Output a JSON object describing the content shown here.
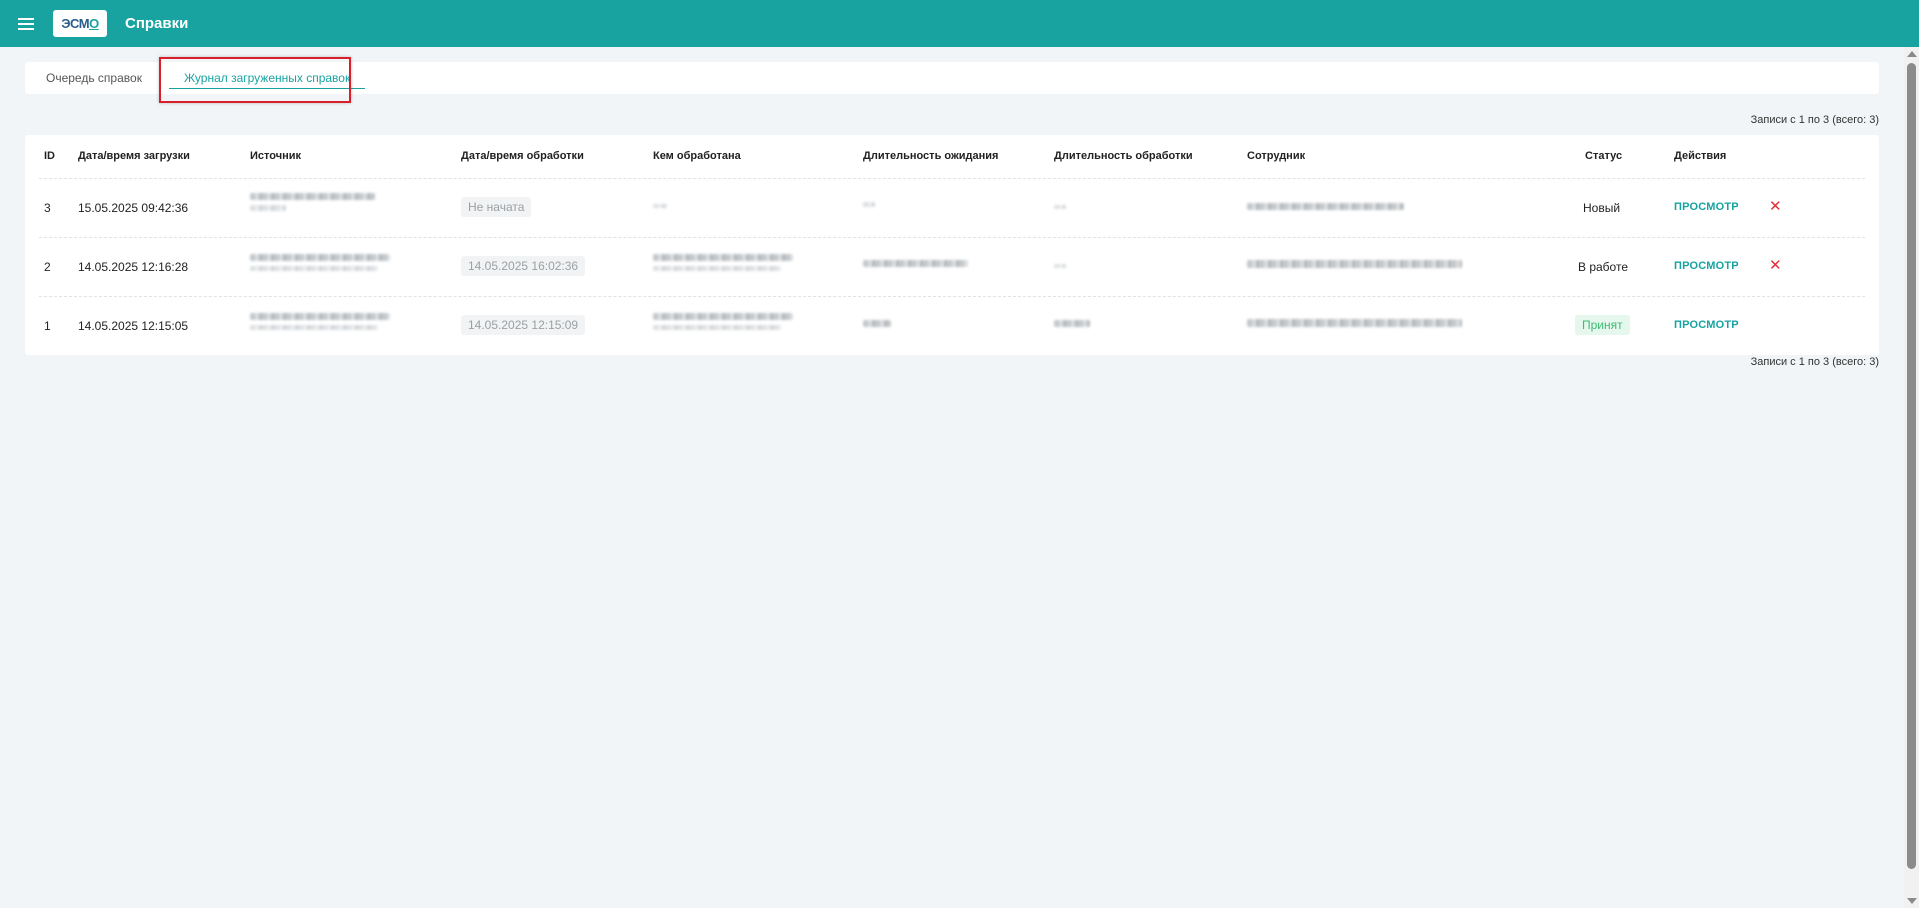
{
  "header": {
    "logo_text_main": "ЭСМ",
    "logo_text_accent": "О",
    "title": "Справки"
  },
  "tabs": [
    {
      "label": "Очередь справок",
      "active": false
    },
    {
      "label": "Журнал загруженных справок",
      "active": true
    }
  ],
  "records_info": "Записи с 1 по 3 (всего: 3)",
  "table": {
    "columns": {
      "id": "ID",
      "uploaded_at": "Дата/время загрузки",
      "source": "Источник",
      "processed_at": "Дата/время обработки",
      "processed_by": "Кем обработана",
      "wait_duration": "Длительность ожидания",
      "process_duration": "Длительность обработки",
      "employee": "Сотрудник",
      "status": "Статус",
      "actions": "Действия"
    },
    "rows": [
      {
        "id": "3",
        "uploaded_at": "15.05.2025 09:42:36",
        "processed_at": "Не начата",
        "status": "Новый",
        "view": "ПРОСМОТР",
        "deletable": true
      },
      {
        "id": "2",
        "uploaded_at": "14.05.2025 12:16:28",
        "processed_at": "14.05.2025 16:02:36",
        "status": "В работе",
        "view": "ПРОСМОТР",
        "deletable": true
      },
      {
        "id": "1",
        "uploaded_at": "14.05.2025 12:15:05",
        "processed_at": "14.05.2025 12:15:09",
        "status": "Принят",
        "view": "ПРОСМОТР",
        "deletable": false
      }
    ]
  },
  "colors": {
    "brand": "#18a3a1",
    "danger": "#e0303a",
    "success": "#3dbb73"
  },
  "icons": {
    "menu": "hamburger-menu-icon",
    "delete": "close-x-icon"
  }
}
